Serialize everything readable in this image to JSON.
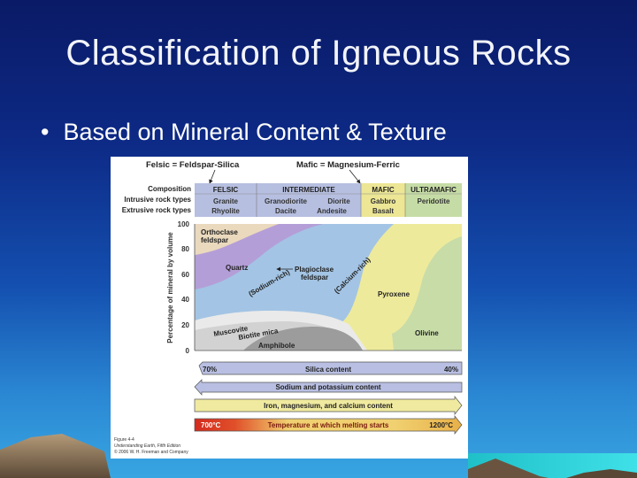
{
  "slide": {
    "title": "Classification of Igneous Rocks",
    "bullet": "Based on Mineral Content & Texture"
  },
  "figure": {
    "felsic_def": "Felsic = Feldspar-Silica",
    "mafic_def": "Mafic = Magnesium-Ferric",
    "row_labels": [
      "Composition",
      "Intrusive rock types",
      "Extrusive rock types"
    ],
    "columns": [
      {
        "name": "FELSIC",
        "intrusive": "Granite",
        "extrusive": "Rhyolite"
      },
      {
        "name": "INTERMEDIATE",
        "intrusive": "Granodiorite",
        "intrusive2": "Diorite",
        "extrusive": "Dacite",
        "extrusive2": "Andesite"
      },
      {
        "name": "MAFIC",
        "intrusive": "Gabbro",
        "extrusive": "Basalt"
      },
      {
        "name": "ULTRAMAFIC",
        "intrusive": "Peridotite",
        "extrusive": ""
      }
    ],
    "y_axis_label": "Percentage of mineral by volume",
    "y_ticks": [
      "100",
      "80",
      "60",
      "40",
      "20",
      "0"
    ],
    "minerals": {
      "orthoclase": "Orthoclase",
      "orthoclase2": "feldspar",
      "quartz": "Quartz",
      "sodium": "(Sodium-rich)",
      "calcium": "(Calcium-rich)",
      "plagioclase": "Plagioclase",
      "plagioclase2": "feldspar",
      "pyroxene": "Pyroxene",
      "muscovite": "Muscovite",
      "biotite": "Biotite mica",
      "olivine": "Olivine",
      "amphibole": "Amphibole"
    },
    "arrows": {
      "silica": "Silica content",
      "silica_left": "70%",
      "silica_right": "40%",
      "sodium_potassium": "Sodium and potassium content",
      "iron_mg_ca": "Iron, magnesium, and calcium content",
      "temperature": "Temperature at which melting starts",
      "temp_left": "700°C",
      "temp_right": "1200°C"
    },
    "credit": [
      "Figure 4-4",
      "Understanding Earth, Fifth Edition",
      "© 2006 W. H. Freeman and Company"
    ],
    "colors": {
      "felsic_header": "#b6bfe0",
      "intermediate_header": "#b6bfe0",
      "mafic_header": "#ece695",
      "ultramafic_header": "#c6dca6",
      "orthoclase": "#ead9bd",
      "quartz": "#b49ed8",
      "plagioclase": "#a3c4e4",
      "pyroxene": "#eeea9c",
      "olivine": "#c8dca8",
      "muscovite": "#eaeaea",
      "biotite": "#d2d2d2",
      "amphibole": "#9c9c9c",
      "silica_arrow": "#b8bfe2",
      "sodium_arrow": "#b8bfe2",
      "iron_arrow": "#f0eaa0",
      "temp_red": "#d42a1e",
      "temp_yellow": "#f0d070"
    }
  }
}
